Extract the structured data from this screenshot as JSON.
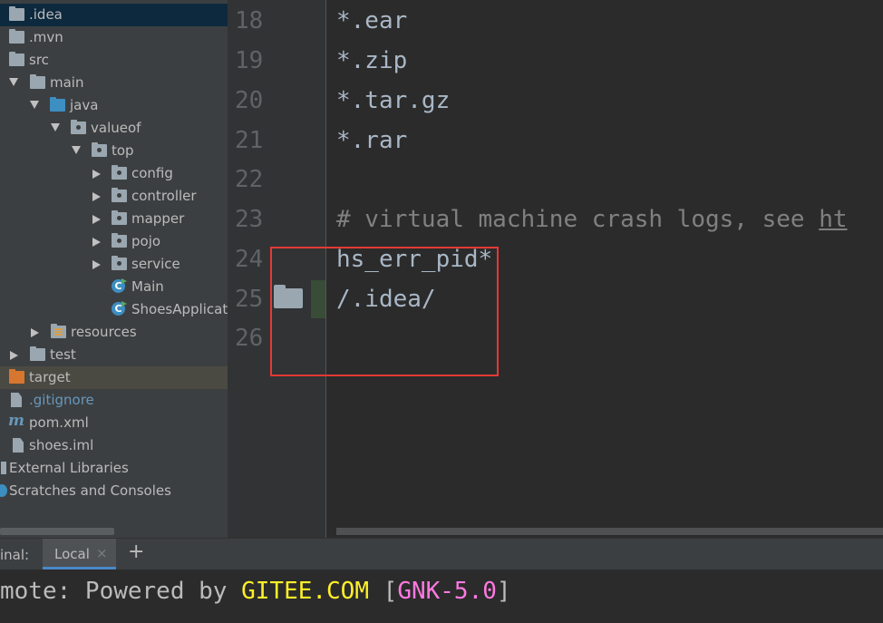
{
  "tree": {
    "items": [
      {
        "label": ".idea"
      },
      {
        "label": ".mvn"
      },
      {
        "label": "src"
      },
      {
        "label": "main"
      },
      {
        "label": "java"
      },
      {
        "label": "valueof"
      },
      {
        "label": "top"
      },
      {
        "label": "config"
      },
      {
        "label": "controller"
      },
      {
        "label": "mapper"
      },
      {
        "label": "pojo"
      },
      {
        "label": "service"
      },
      {
        "label": "Main"
      },
      {
        "label": "ShoesApplicat"
      },
      {
        "label": "resources"
      },
      {
        "label": "test"
      },
      {
        "label": "target"
      },
      {
        "label": ".gitignore"
      },
      {
        "label": "pom.xml"
      },
      {
        "label": "shoes.iml"
      },
      {
        "label": "External Libraries"
      },
      {
        "label": "Scratches and Consoles"
      }
    ]
  },
  "editor": {
    "lines": [
      {
        "num": "18",
        "text": "*.ear"
      },
      {
        "num": "19",
        "text": "*.zip"
      },
      {
        "num": "20",
        "text": "*.tar.gz"
      },
      {
        "num": "21",
        "text": "*.rar"
      },
      {
        "num": "22",
        "text": ""
      },
      {
        "num": "23",
        "text": "# virtual machine crash logs, see ",
        "link": "ht"
      },
      {
        "num": "24",
        "text": "hs_err_pid*"
      },
      {
        "num": "25",
        "text": "/.idea/"
      },
      {
        "num": "26",
        "text": ""
      }
    ]
  },
  "terminal": {
    "label": "inal:",
    "tab_label": "Local",
    "close_glyph": "×",
    "add_glyph": "+",
    "line1": {
      "prefix": "mote: Powered by ",
      "host": "GITEE.COM",
      "mid": " [",
      "tag": "GNK-5.0",
      "suffix": "]"
    }
  },
  "colors": {
    "selection": "#0d293e",
    "excluded_row": "#4b4a42",
    "annotation_box": "#e53935",
    "terminal_highlight": "#ffef28",
    "terminal_tag": "#ff79e1"
  }
}
